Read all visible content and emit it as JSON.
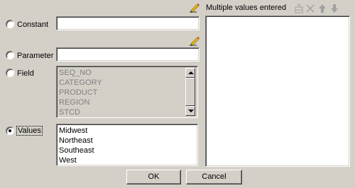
{
  "options": {
    "constant_label": "Constant",
    "parameter_label": "Parameter",
    "field_label": "Field",
    "values_label": "Values",
    "selected": "values"
  },
  "field_list": [
    "SEQ_NO",
    "CATEGORY",
    "PRODUCT",
    "REGION",
    "STCD"
  ],
  "values_list": [
    "Midwest",
    "Northeast",
    "Southeast",
    "West"
  ],
  "right_panel": {
    "title": "Multiple values entered",
    "toolbar_icons": [
      "add-row-icon",
      "delete-icon",
      "move-up-icon",
      "move-down-icon"
    ]
  },
  "buttons": {
    "ok": "OK",
    "cancel": "Cancel"
  },
  "icons": [
    "pencil-edit-icon"
  ],
  "colors": {
    "dialog_bg": "#d4d0c8",
    "field_bg": "#ffffff",
    "disabled_text": "#808080",
    "pencil_yellow": "#f0c000"
  }
}
